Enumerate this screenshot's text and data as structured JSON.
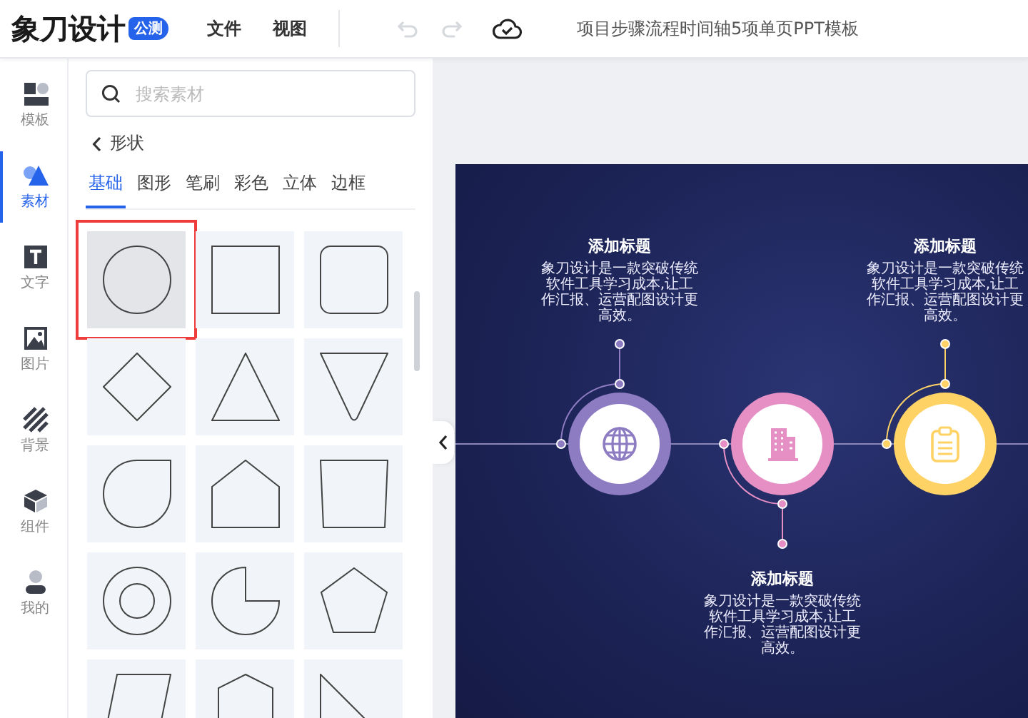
{
  "header": {
    "logo": "象刀设计",
    "badge": "公测",
    "menus": [
      "文件",
      "视图"
    ],
    "undo_disabled": true,
    "redo_disabled": true,
    "document_title": "项目步骤流程时间轴5项单页PPT模板"
  },
  "rail": [
    {
      "kind": "template",
      "label": "模板",
      "selected": false
    },
    {
      "kind": "material",
      "label": "素材",
      "selected": true
    },
    {
      "kind": "text",
      "label": "文字",
      "selected": false
    },
    {
      "kind": "image",
      "label": "图片",
      "selected": false
    },
    {
      "kind": "background",
      "label": "背景",
      "selected": false
    },
    {
      "kind": "component",
      "label": "组件",
      "selected": false
    },
    {
      "kind": "mine",
      "label": "我的",
      "selected": false
    }
  ],
  "panel": {
    "search": {
      "placeholder": "搜索素材"
    },
    "back": "形状",
    "tabs": [
      {
        "label": "基础",
        "selected": true
      },
      {
        "label": "图形",
        "selected": false
      },
      {
        "label": "笔刷",
        "selected": false
      },
      {
        "label": "彩色",
        "selected": false
      },
      {
        "label": "立体",
        "selected": false
      },
      {
        "label": "边框",
        "selected": false
      }
    ],
    "shapes": [
      {
        "kind": "circle",
        "selected": true
      },
      {
        "kind": "square",
        "selected": false
      },
      {
        "kind": "rounded-square",
        "selected": false
      },
      {
        "kind": "diamond",
        "selected": false
      },
      {
        "kind": "triangle",
        "selected": false
      },
      {
        "kind": "inverted-triangle",
        "selected": false
      },
      {
        "kind": "drop",
        "selected": false
      },
      {
        "kind": "house",
        "selected": false
      },
      {
        "kind": "trapezoid",
        "selected": false
      },
      {
        "kind": "ring",
        "selected": false
      },
      {
        "kind": "pie",
        "selected": false
      },
      {
        "kind": "pentagon",
        "selected": false
      },
      {
        "kind": "parallelogram",
        "selected": false
      },
      {
        "kind": "hexagon",
        "selected": false
      },
      {
        "kind": "right-triangle",
        "selected": false
      }
    ]
  },
  "slide": {
    "steps": [
      {
        "kind": "globe",
        "color": "#8e7cc3",
        "title": "添加标题",
        "text": "象刀设计是一款突破传统软件工具学习成本,让工作汇报、运营配图设计更高效。"
      },
      {
        "kind": "building",
        "color": "#e58fc4",
        "title": "添加标题",
        "text": "象刀设计是一款突破传统软件工具学习成本,让工作汇报、运营配图设计更高效。"
      },
      {
        "kind": "clipboard",
        "color": "#ffd266",
        "title": "添加标题",
        "text": "象刀设计是一款突破传统软件工具学习成本,让工作汇报、运营配图设计更高效。"
      }
    ]
  }
}
